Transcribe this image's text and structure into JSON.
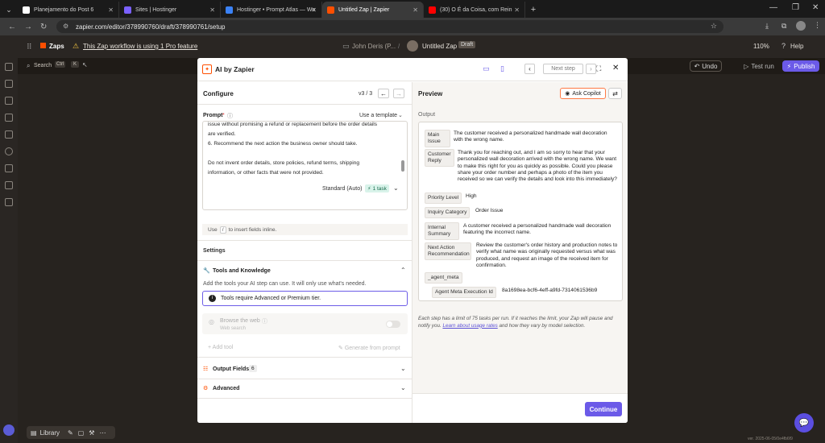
{
  "browser": {
    "tabs": [
      {
        "title": "Planejamento do Post 6",
        "color": "#ffffff"
      },
      {
        "title": "Sites | Hostinger",
        "color": "#7b61ff"
      },
      {
        "title": "Hostinger • Prompt Atlas — Wo",
        "color": "#3b82f6"
      },
      {
        "title": "Untitled Zap | Zapier",
        "color": "#ff4f00",
        "active": true
      },
      {
        "title": "(30) O É da Coisa, com Rein",
        "color": "#ff0000"
      }
    ],
    "new_tab": "+",
    "url": "zapier.com/editor/378990760/draft/378990761/setup"
  },
  "app": {
    "logo": "Zaps",
    "pro_notice": "This Zap workflow is using 1 Pro feature",
    "user": "John Deris (P...",
    "zap_name": "Untitled Zap",
    "draft_badge": "Draft",
    "zoom": "110%",
    "help": "Help",
    "search_label": "Search",
    "search_shortcut": "Ctrl",
    "undo": "Undo",
    "test_run": "Test run",
    "publish": "Publish",
    "library": "Library",
    "version": "ver. 2025-06-05/0e4fb6f9"
  },
  "modal": {
    "title": "AI by Zapier",
    "next_step": "Next step",
    "configure": {
      "title": "Configure",
      "version": "v3 / 3",
      "prompt_label": "Prompt",
      "prompt_required": "*",
      "use_template": "Use a template",
      "prompt_lines": [
        "issue without promising a refund or replacement before the order details",
        "are verified.",
        "6. Recommend the next action the business owner should take.",
        "",
        "Do not invent order details, store policies, refund terms, shipping",
        "information, or other facts that were not provided."
      ],
      "model": "Standard (Auto)",
      "task_badge": "1 task",
      "insert_hint_prefix": "Use",
      "insert_hint_key": "/",
      "insert_hint_suffix": "to insert fields inline.",
      "settings": "Settings",
      "tools_title": "Tools and Knowledge",
      "tools_desc": "Add the tools your AI step can use. It will only use what's needed.",
      "tools_notice": "Tools require Advanced or Premium tier.",
      "browse_title": "Browse the web",
      "browse_sub": "Web search",
      "add_tool": "Add tool",
      "generate_prompt": "Generate from prompt",
      "output_fields": "Output Fields",
      "output_fields_count": "6",
      "advanced": "Advanced"
    },
    "preview": {
      "title": "Preview",
      "ask_copilot": "Ask Copilot",
      "output_label": "Output",
      "rows": [
        {
          "label": "Main Issue",
          "value": "The customer received a personalized handmade wall decoration with the wrong name."
        },
        {
          "label": "Customer Reply",
          "value": "Thank you for reaching out, and I am so sorry to hear that your personalized wall decoration arrived with the wrong name. We want to make this right for you as quickly as possible. Could you please share your order number and perhaps a photo of the item you received so we can verify the details and look into this immediately?"
        },
        {
          "label": "Priority Level",
          "value": "High"
        },
        {
          "label": "Inquiry Category",
          "value": "Order Issue"
        },
        {
          "label": "Internal Summary",
          "value": "A customer received a personalized handmade wall decoration featuring the incorrect name."
        },
        {
          "label": "Next Action Recommendation",
          "value": "Review the customer's order history and production notes to verify what name was originally requested versus what was produced, and request an image of the received item for confirmation."
        },
        {
          "label": "_agent_meta",
          "value": ""
        },
        {
          "label": "Agent Meta Execution Id",
          "value": "8a1698ea-bcf6-4eff-a9fd-7314061536b9"
        }
      ],
      "limit_note_1": "Each step has a limit of 75 tasks per run. If it reaches the limit, your Zap will pause",
      "limit_note_2a": "and notify you.",
      "limit_link": "Learn about usage rates",
      "limit_note_2b": "and how they vary by model selection."
    },
    "continue": "Continue"
  },
  "colors": {
    "accent": "#695be8",
    "zapier_orange": "#ff4f00",
    "publish_bg": "#6b5ae8"
  }
}
